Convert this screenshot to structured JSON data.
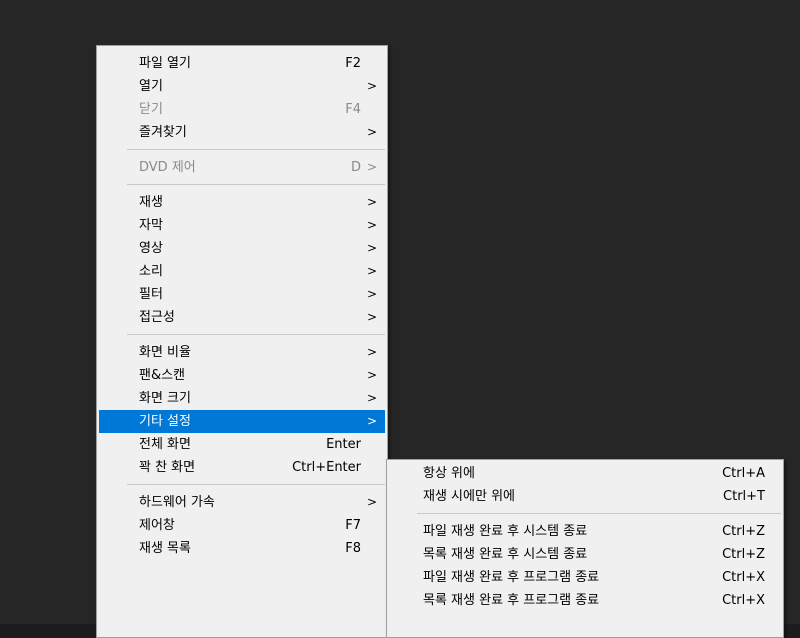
{
  "main_menu": {
    "items": [
      {
        "label": "파일 열기",
        "shortcut": "F2",
        "arrow": ""
      },
      {
        "label": "열기",
        "shortcut": "",
        "arrow": ">"
      },
      {
        "label": "닫기",
        "shortcut": "F4",
        "arrow": ""
      },
      {
        "label": "즐겨찾기",
        "shortcut": "",
        "arrow": ">"
      },
      {
        "label": "DVD 제어",
        "shortcut": "D",
        "arrow": ">"
      },
      {
        "label": "재생",
        "shortcut": "",
        "arrow": ">"
      },
      {
        "label": "자막",
        "shortcut": "",
        "arrow": ">"
      },
      {
        "label": "영상",
        "shortcut": "",
        "arrow": ">"
      },
      {
        "label": "소리",
        "shortcut": "",
        "arrow": ">"
      },
      {
        "label": "필터",
        "shortcut": "",
        "arrow": ">"
      },
      {
        "label": "접근성",
        "shortcut": "",
        "arrow": ">"
      },
      {
        "label": "화면 비율",
        "shortcut": "",
        "arrow": ">"
      },
      {
        "label": "팬&스캔",
        "shortcut": "",
        "arrow": ">"
      },
      {
        "label": "화면 크기",
        "shortcut": "",
        "arrow": ">"
      },
      {
        "label": "기타 설정",
        "shortcut": "",
        "arrow": ">"
      },
      {
        "label": "전체 화면",
        "shortcut": "Enter",
        "arrow": ""
      },
      {
        "label": "꽉 찬 화면",
        "shortcut": "Ctrl+Enter",
        "arrow": ""
      },
      {
        "label": "하드웨어 가속",
        "shortcut": "",
        "arrow": ">"
      },
      {
        "label": "제어창",
        "shortcut": "F7",
        "arrow": ""
      },
      {
        "label": "재생 목록",
        "shortcut": "F8",
        "arrow": ""
      }
    ]
  },
  "sub_menu": {
    "items": [
      {
        "label": "항상 위에",
        "shortcut": "Ctrl+A"
      },
      {
        "label": "재생 시에만 위에",
        "shortcut": "Ctrl+T"
      },
      {
        "label": "파일 재생 완료 후 시스템 종료",
        "shortcut": "Ctrl+Z"
      },
      {
        "label": "목록 재생 완료 후 시스템 종료",
        "shortcut": "Ctrl+Z"
      },
      {
        "label": "파일 재생 완료 후 프로그램 종료",
        "shortcut": "Ctrl+X"
      },
      {
        "label": "목록 재생 완료 후 프로그램 종료",
        "shortcut": "Ctrl+X"
      }
    ]
  },
  "colors": {
    "background": "#262626",
    "menu_bg": "#f0f0f0",
    "highlight": "#0078d7",
    "disabled_text": "#8a8a8a"
  }
}
